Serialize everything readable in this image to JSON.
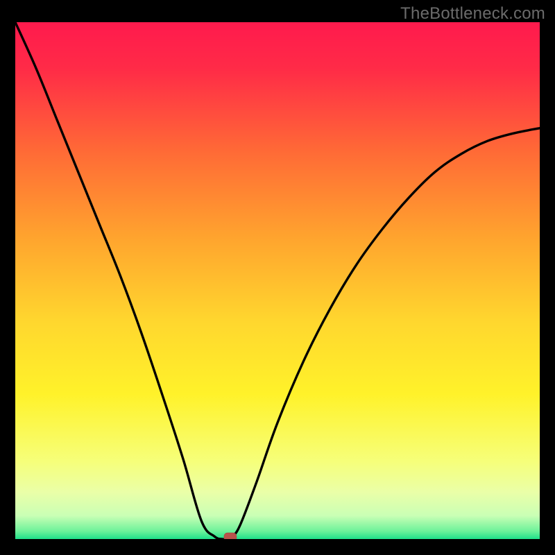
{
  "watermark": "TheBottleneck.com",
  "colors": {
    "frame": "#000000",
    "curve": "#000000",
    "text": "#6b6b6b",
    "marker_fill": "#b9534b",
    "marker_stroke": "#a9463f",
    "gradient_stops": [
      {
        "offset": 0,
        "color": "#ff1a4d"
      },
      {
        "offset": 0.09,
        "color": "#ff2b47"
      },
      {
        "offset": 0.25,
        "color": "#ff6a36"
      },
      {
        "offset": 0.42,
        "color": "#ffa52e"
      },
      {
        "offset": 0.58,
        "color": "#ffd72e"
      },
      {
        "offset": 0.72,
        "color": "#fff22a"
      },
      {
        "offset": 0.85,
        "color": "#f6ff7a"
      },
      {
        "offset": 0.91,
        "color": "#eaffa8"
      },
      {
        "offset": 0.955,
        "color": "#c9ffb5"
      },
      {
        "offset": 0.985,
        "color": "#6cf29a"
      },
      {
        "offset": 1.0,
        "color": "#1ee08a"
      }
    ]
  },
  "chart_data": {
    "type": "line",
    "title": "",
    "xlabel": "",
    "ylabel": "",
    "xlim": [
      0,
      1
    ],
    "ylim": [
      0,
      1
    ],
    "legend": false,
    "grid": false,
    "series": [
      {
        "name": "bottleneck-curve",
        "x": [
          0.0,
          0.04,
          0.08,
          0.12,
          0.16,
          0.2,
          0.24,
          0.28,
          0.32,
          0.355,
          0.38,
          0.395,
          0.405,
          0.415,
          0.43,
          0.46,
          0.5,
          0.55,
          0.6,
          0.65,
          0.7,
          0.75,
          0.8,
          0.85,
          0.9,
          0.95,
          1.0
        ],
        "y": [
          1.0,
          0.91,
          0.81,
          0.71,
          0.61,
          0.51,
          0.4,
          0.28,
          0.155,
          0.035,
          0.005,
          0.0,
          0.0,
          0.005,
          0.03,
          0.11,
          0.225,
          0.345,
          0.445,
          0.53,
          0.6,
          0.66,
          0.71,
          0.745,
          0.77,
          0.785,
          0.795
        ]
      }
    ],
    "marker": {
      "name": "optimal-point",
      "x": 0.41,
      "y": 0.004
    }
  }
}
